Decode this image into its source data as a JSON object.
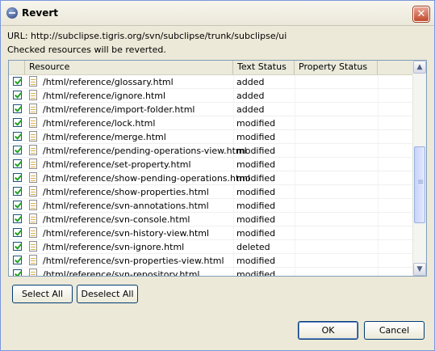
{
  "window": {
    "title": "Revert",
    "close_glyph": "✕"
  },
  "info": {
    "url_line": "URL: http://subclipse.tigris.org/svn/subclipse/trunk/subclipse/ui",
    "checked_line": "Checked resources will be reverted."
  },
  "table": {
    "columns": [
      "Resource",
      "Text Status",
      "Property Status"
    ],
    "rows": [
      {
        "checked": true,
        "icon": "file-icon",
        "resource": "/html/reference/glossary.html",
        "text_status": "added",
        "property_status": ""
      },
      {
        "checked": true,
        "icon": "file-icon",
        "resource": "/html/reference/ignore.html",
        "text_status": "added",
        "property_status": ""
      },
      {
        "checked": true,
        "icon": "file-icon",
        "resource": "/html/reference/import-folder.html",
        "text_status": "added",
        "property_status": ""
      },
      {
        "checked": true,
        "icon": "file-icon",
        "resource": "/html/reference/lock.html",
        "text_status": "modified",
        "property_status": ""
      },
      {
        "checked": true,
        "icon": "file-icon",
        "resource": "/html/reference/merge.html",
        "text_status": "modified",
        "property_status": ""
      },
      {
        "checked": true,
        "icon": "file-icon",
        "resource": "/html/reference/pending-operations-view.html",
        "text_status": "modified",
        "property_status": ""
      },
      {
        "checked": true,
        "icon": "file-icon",
        "resource": "/html/reference/set-property.html",
        "text_status": "modified",
        "property_status": ""
      },
      {
        "checked": true,
        "icon": "file-icon",
        "resource": "/html/reference/show-pending-operations.html",
        "text_status": "modified",
        "property_status": ""
      },
      {
        "checked": true,
        "icon": "file-icon",
        "resource": "/html/reference/show-properties.html",
        "text_status": "modified",
        "property_status": ""
      },
      {
        "checked": true,
        "icon": "file-icon",
        "resource": "/html/reference/svn-annotations.html",
        "text_status": "modified",
        "property_status": ""
      },
      {
        "checked": true,
        "icon": "file-icon",
        "resource": "/html/reference/svn-console.html",
        "text_status": "modified",
        "property_status": ""
      },
      {
        "checked": true,
        "icon": "file-icon",
        "resource": "/html/reference/svn-history-view.html",
        "text_status": "modified",
        "property_status": ""
      },
      {
        "checked": true,
        "icon": "file-icon",
        "resource": "/html/reference/svn-ignore.html",
        "text_status": "deleted",
        "property_status": ""
      },
      {
        "checked": true,
        "icon": "file-icon",
        "resource": "/html/reference/svn-properties-view.html",
        "text_status": "modified",
        "property_status": ""
      },
      {
        "checked": true,
        "icon": "file-icon",
        "resource": "/html/reference/svn-repository.html",
        "text_status": "modified",
        "property_status": ""
      }
    ]
  },
  "scrollbar": {
    "up_glyph": "▲",
    "down_glyph": "▼"
  },
  "buttons": {
    "select_all": "Select All",
    "deselect_all": "Deselect All",
    "ok": "OK",
    "cancel": "Cancel"
  },
  "colors": {
    "title_bar": "#ebe8d9",
    "dialog_bg": "#ece9d8",
    "close_button": "#c14a2b",
    "checkmark": "#21a121"
  }
}
